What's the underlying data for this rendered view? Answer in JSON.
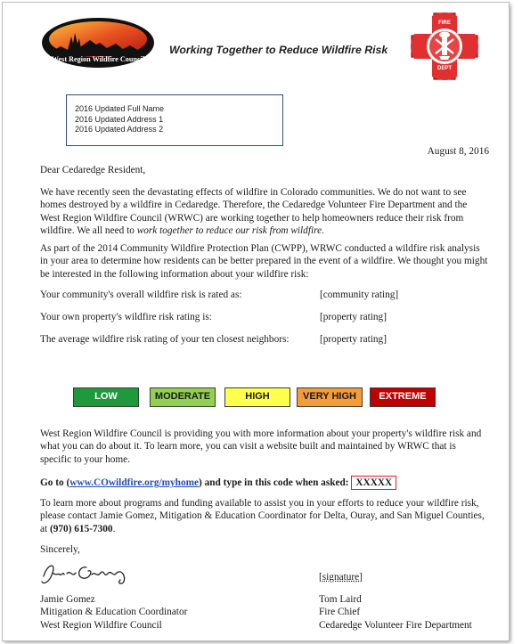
{
  "header": {
    "logo_text": "West Region Wildfire Council",
    "tagline": "Working Together to Reduce Wildfire Risk",
    "fire_badge_top": "FIRE",
    "fire_badge_bottom": "DEPT"
  },
  "address": {
    "line1": "2016 Updated Full Name",
    "line2": "2016 Updated Address 1",
    "line3": "2016 Updated Address 2"
  },
  "date": "August 8, 2016",
  "salutation": "Dear Cedaredge Resident,",
  "para1_main": "We have recently seen the devastating effects of wildfire in Colorado communities. We do not want to see homes destroyed by a wildfire in Cedaredge. Therefore, the Cedaredge Volunteer Fire Department and the West Region Wildfire Council (WRWC) are working together to help homeowners reduce their risk from wildfire. We all need to ",
  "para1_italic": "work together to reduce our risk from wildfire.",
  "para2": "As part of the 2014 Community Wildfire Protection Plan (CWPP), WRWC conducted a wildfire risk analysis in your area to determine how residents can be better prepared in the event of a wildfire. We thought you might be interested in the following information about your wildfire risk:",
  "ratings": [
    {
      "label": "Your community's overall wildfire risk is rated as:",
      "value": "[community rating]"
    },
    {
      "label": "Your own property's wildfire risk rating is:",
      "value": "[property rating]"
    },
    {
      "label": "The average wildfire risk rating of your ten closest neighbors:",
      "value": "[property rating]"
    }
  ],
  "scale": [
    {
      "label": "LOW",
      "bg": "#1e9a3c",
      "fg": "#ffffff"
    },
    {
      "label": "MODERATE",
      "bg": "#92d050",
      "fg": "#1a1a1a"
    },
    {
      "label": "HIGH",
      "bg": "#ffff4d",
      "fg": "#1a1a1a"
    },
    {
      "label": "VERY HIGH",
      "bg": "#f59b3a",
      "fg": "#1a1a1a"
    },
    {
      "label": "EXTREME",
      "bg": "#c00000",
      "fg": "#ffffff"
    }
  ],
  "para3": "West Region Wildfire Council is providing you with more information about your property's wildfire risk and what you can do about it. To learn more, you can visit a website built and maintained by WRWC that is specific to your home.",
  "goto": {
    "prefix": "Go to (",
    "url": "www.COwildfire.org/myhome",
    "suffix": ") and type in this code when asked:",
    "code": "XXXXX"
  },
  "para4_main": "To learn more about programs and funding available to assist you in your efforts to reduce your wildfire risk, please contact Jamie Gomez, Mitigation & Education Coordinator for Delta, Ouray, and San Miguel Counties, at ",
  "para4_phone": "(970) 615-7300",
  "para4_end": ".",
  "closing": "Sincerely,",
  "signature_placeholder": "[signature]",
  "signer_left": {
    "name": "Jamie Gomez",
    "title": "Mitigation & Education Coordinator",
    "org": "West Region Wildfire Council"
  },
  "signer_right": {
    "name": "Tom Laird",
    "title": "Fire Chief",
    "org": "Cedaredge Volunteer Fire Department"
  }
}
